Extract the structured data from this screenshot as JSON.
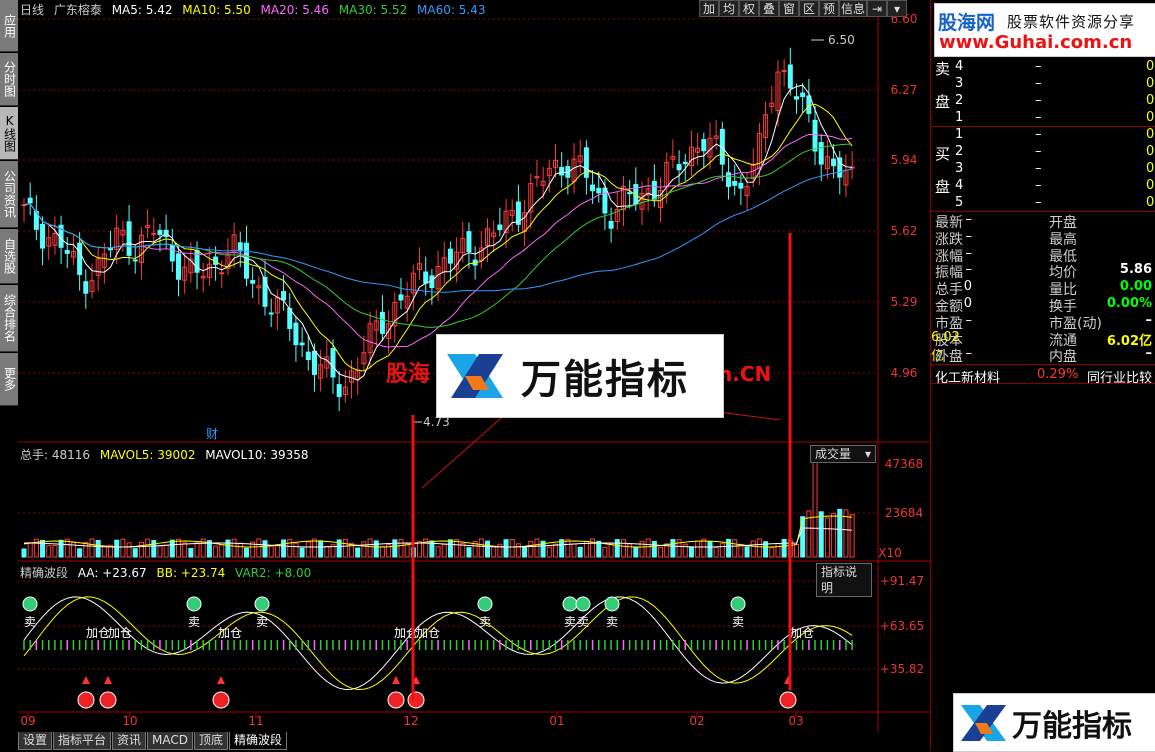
{
  "left_tabs": [
    {
      "label": "应用",
      "active": false
    },
    {
      "label": "分时图",
      "active": false
    },
    {
      "label": "K线图",
      "active": true
    },
    {
      "label": "公司资讯",
      "active": false
    },
    {
      "label": "自选股",
      "active": false
    },
    {
      "label": "综合排名",
      "active": false
    },
    {
      "label": "更多",
      "active": false
    }
  ],
  "toolbar": [
    "加",
    "均",
    "权",
    "叠",
    "窗",
    "区",
    "预",
    "信息",
    "⇥",
    "▾"
  ],
  "main_legend": {
    "period": "日线",
    "name": "广东榕泰",
    "ma5": "MA5: 5.42",
    "ma10": "MA10: 5.50",
    "ma20": "MA20: 5.46",
    "ma30": "MA30: 5.52",
    "ma60": "MA60: 5.43"
  },
  "price_axis": [
    "6.60",
    "6.27",
    "5.94",
    "5.62",
    "5.29",
    "4.96"
  ],
  "price_markers": {
    "high": "6.50",
    "low": "4.73",
    "cai": "财"
  },
  "volume_legend": {
    "total": "总手: 48116",
    "mavol5": "MAVOL5: 39002",
    "mavol10": "MAVOL10: 39358"
  },
  "volume_axis": [
    "47368",
    "23684",
    "X10"
  ],
  "volume_dropdown": "成交量",
  "indicator_legend": {
    "name": "精确波段",
    "aa": "AA: +23.67",
    "bb": "BB: +23.74",
    "var2": "VAR2: +8.00"
  },
  "indicator_axis": [
    "+91.47",
    "+63.65",
    "+35.82"
  ],
  "indicator_dropdown": "指标说明",
  "signal_labels": {
    "sell": "卖",
    "add": "加仓"
  },
  "date_axis": [
    "09",
    "10",
    "11",
    "12",
    "01",
    "02",
    "03"
  ],
  "bottom_tabs": [
    {
      "label": "设置",
      "active": false
    },
    {
      "label": "指标平台",
      "active": false
    },
    {
      "label": "资讯",
      "active": false
    },
    {
      "label": "MACD",
      "active": false
    },
    {
      "label": "顶底",
      "active": false
    },
    {
      "label": "精确波段",
      "active": true
    }
  ],
  "right_panel": {
    "sell_label": [
      "卖",
      "盘"
    ],
    "buy_label": [
      "买",
      "盘"
    ],
    "sell_levels": [
      {
        "n": "4",
        "p": "–",
        "v": "0"
      },
      {
        "n": "3",
        "p": "–",
        "v": "0"
      },
      {
        "n": "2",
        "p": "–",
        "v": "0"
      },
      {
        "n": "1",
        "p": "–",
        "v": "0"
      }
    ],
    "buy_levels": [
      {
        "n": "1",
        "p": "–",
        "v": "0"
      },
      {
        "n": "2",
        "p": "–",
        "v": "0"
      },
      {
        "n": "3",
        "p": "–",
        "v": "0"
      },
      {
        "n": "4",
        "p": "–",
        "v": "0"
      },
      {
        "n": "5",
        "p": "–",
        "v": "0"
      }
    ],
    "stats": [
      {
        "l1": "最新",
        "v1": "–",
        "l2": "开盘",
        "v2": ""
      },
      {
        "l1": "涨跌",
        "v1": "–",
        "l2": "最高",
        "v2": ""
      },
      {
        "l1": "涨幅",
        "v1": "–",
        "l2": "最低",
        "v2": ""
      },
      {
        "l1": "振幅",
        "v1": "–",
        "l2": "均价",
        "v2": "5.86"
      },
      {
        "l1": "总手",
        "v1": "0",
        "l2": "量比",
        "v2": "0.00"
      },
      {
        "l1": "金额",
        "v1": "0",
        "l2": "换手",
        "v2": "0.00%"
      },
      {
        "l1": "市盈",
        "v1": "–",
        "l2": "市盈(动)",
        "v2": "–"
      },
      {
        "l1": "股本",
        "v1": "6.02亿",
        "l2": "流通",
        "v2": "6.02亿"
      },
      {
        "l1": "外盘",
        "v1": "–",
        "l2": "内盘",
        "v2": "–"
      }
    ],
    "industry": {
      "name": "化工新材料",
      "pct": "0.29%",
      "compare": "同行业比较"
    }
  },
  "watermarks": {
    "guhai_cn": "股海网",
    "guhai_sub": "股票软件资源分享",
    "guhai_url": "www.Guhai.com.cn",
    "wanneng": "万能指标",
    "center_red_left": "股海",
    "center_red_right": "n.CN"
  },
  "colors": {
    "up": "#ff3b3b",
    "down": "#54ffff",
    "ma5": "#ffffff",
    "ma10": "#ffff00",
    "ma20": "#ff66ff",
    "ma30": "#33cc33",
    "ma60": "#3399ff"
  }
}
